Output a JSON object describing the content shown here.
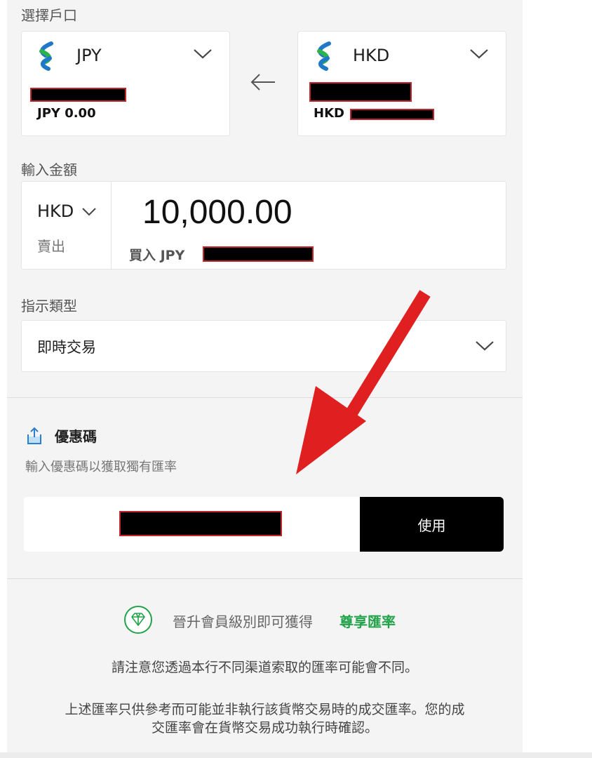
{
  "accounts": {
    "label": "選擇戶口",
    "to": {
      "currency": "JPY",
      "balance": "JPY 0.00"
    },
    "from": {
      "currency": "HKD",
      "balance_prefix": "HKD"
    }
  },
  "amount": {
    "label": "輸入金額",
    "sell_currency": "HKD",
    "sell_label": "賣出",
    "value": "10,000.00",
    "buy_prefix": "買入 JPY"
  },
  "instruction": {
    "label": "指示類型",
    "value": "即時交易"
  },
  "promo": {
    "title": "優惠碼",
    "subtitle": "輸入優惠碼以獲取獨有匯率",
    "apply_label": "使用"
  },
  "footer": {
    "upgrade_text": "晉升會員級別即可獲得",
    "upgrade_link": "尊享匯率",
    "note1": "請注意您透過本行不同渠道索取的匯率可能會不同。",
    "note2_line1": "上述匯率只供參考而可能並非執行該貨幣交易時的成交匯率。您的成",
    "note2_line2": "交匯率會在貨幣交易成功執行時確認。"
  },
  "colors": {
    "panel_bg": "#f4f4f4",
    "accent_green": "#22a34a",
    "apply_button_bg": "#000000",
    "annotation_arrow": "#e02020"
  }
}
